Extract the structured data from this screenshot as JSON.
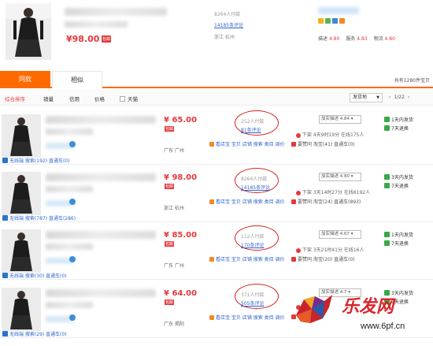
{
  "top": {
    "price": "¥98.00",
    "badge": "包邮",
    "sales": "8264人付款",
    "reviews": "14185条评论",
    "location": "浙江 杭州",
    "scores": [
      {
        "label": "描述",
        "value": "4.80"
      },
      {
        "label": "服务",
        "value": "4.83"
      },
      {
        "label": "物流",
        "value": "4.80"
      }
    ]
  },
  "tabs": [
    {
      "label": "同款",
      "active": true
    },
    {
      "label": "相似",
      "active": false
    }
  ],
  "total": "共有1280件宝贝",
  "sort": {
    "items": [
      "综合排序",
      "销量",
      "信用",
      "价格"
    ],
    "tmall": "天猫",
    "ship_select": "发货地",
    "pager": {
      "prev": "‹",
      "page": "1/22",
      "next": "›"
    }
  },
  "items": [
    {
      "price": "¥ 65.00",
      "badge": "包邮",
      "location": "广东 广州",
      "sales": "252人付款",
      "reviews": "81条评论",
      "desc": "加实描述 4.84",
      "timer": "下架 4天9时19分  在线175人",
      "links": "看店宝 宝贝 店铺 搜索 类目 调价",
      "fav": "要赞同 淘宝(41) 直通车(0)",
      "ww": "无线端 搜索(192) 直通车(0)",
      "services": [
        "1天内发货",
        "7天退换"
      ]
    },
    {
      "price": "¥ 98.00",
      "badge": "包邮",
      "location": "浙江 杭州",
      "sales": "8264人付款",
      "reviews": "14185条评论",
      "desc": "加实描述 4.80",
      "timer": "下架 3天14时27分  在线6192人",
      "links": "看店宝 宝贝 店铺 搜索 类目 调价",
      "fav": "要赞同 淘宝(24) 直通车(893)",
      "ww": "无线端 搜索(787) 直通车(286)",
      "services": [
        "3天内发货",
        "7天退换"
      ]
    },
    {
      "price": "¥ 85.00",
      "badge": "包邮",
      "location": "广东 广州",
      "sales": "112人付款",
      "reviews": "170条评论",
      "desc": "加实描述 4.67",
      "timer": "下架 3天21时41分  在线16人",
      "links": "看店宝 宝贝 店铺 搜索 类目 调价",
      "fav": "要赞同 淘宝(20) 直通车(0)",
      "ww": "无线端 搜索(30) 直通车(0)",
      "services": [
        "1天内发货",
        "7天退换"
      ]
    },
    {
      "price": "¥ 64.00",
      "badge": "包邮",
      "location": "广东 揭阳",
      "sales": "371人付款",
      "reviews": "505条评论",
      "desc": "加实描述 4.7",
      "timer": "",
      "links": "看店宝 宝贝 店铺 搜索 类目 调价",
      "fav": "133",
      "ww": "无线端 搜索(29) 直通车(0)",
      "services": [
        "3天内发货",
        "7天退换"
      ]
    }
  ],
  "watermark": {
    "text": "乐发网",
    "url": "www.6pf.cn"
  },
  "colors": {
    "accent": "#ff6a00",
    "price": "#e4393c",
    "link": "#3366cc",
    "circle": "#d82020"
  }
}
